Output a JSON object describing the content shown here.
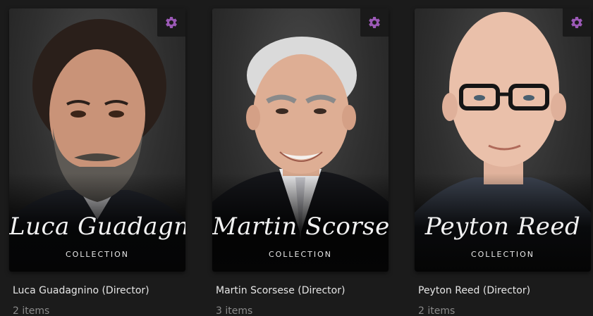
{
  "accent_color": "#9b59b6",
  "collections": [
    {
      "script_name": "Luca Guadagnino",
      "collection_label": "COLLECTION",
      "title": "Luca Guadagnino (Director)",
      "count": "2 items",
      "settings_icon": "gear-icon"
    },
    {
      "script_name": "Martin Scorsese",
      "collection_label": "COLLECTION",
      "title": "Martin Scorsese (Director)",
      "count": "3 items",
      "settings_icon": "gear-icon"
    },
    {
      "script_name": "Peyton Reed",
      "collection_label": "COLLECTION",
      "title": "Peyton Reed (Director)",
      "count": "2 items",
      "settings_icon": "gear-icon"
    }
  ]
}
